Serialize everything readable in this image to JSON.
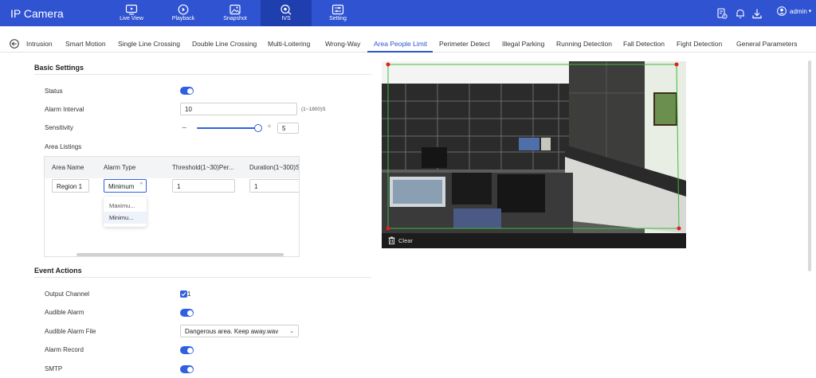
{
  "app": {
    "title": "IP Camera"
  },
  "nav": [
    {
      "label": "Live View",
      "icon": "live-view-icon"
    },
    {
      "label": "Playback",
      "icon": "playback-icon"
    },
    {
      "label": "Snapshot",
      "icon": "snapshot-icon"
    },
    {
      "label": "IVS",
      "icon": "ivs-icon",
      "active": true
    },
    {
      "label": "Setting",
      "icon": "setting-icon"
    }
  ],
  "user": {
    "name": "admin",
    "chevron": "▾"
  },
  "tabs": [
    "Intrusion",
    "Smart Motion",
    "Single Line Crossing",
    "Double Line Crossing",
    "Multi-Loitering",
    "Wrong-Way",
    "Area People Limit",
    "Perimeter Detect",
    "Illegal Parking",
    "Running Detection",
    "Fall Detection",
    "Fight Detection",
    "General Parameters"
  ],
  "active_tab": "Area People Limit",
  "basic": {
    "title": "Basic Settings",
    "status_label": "Status",
    "status_on": true,
    "interval_label": "Alarm Interval",
    "interval_value": "10",
    "interval_hint": "(1~1800)S",
    "sensitivity_label": "Sensitivity",
    "sensitivity_minus": "−",
    "sensitivity_plus": "+",
    "sensitivity_value": "5",
    "area_listings_label": "Area Listings"
  },
  "area_table": {
    "headers": [
      "Area Name",
      "Alarm Type",
      "Threshold(1~30)Per...",
      "Duration(1~300)S"
    ],
    "row": {
      "name": "Region 1",
      "alarm_type": "Minimum",
      "threshold": "1",
      "duration": "1"
    },
    "dropdown_options": [
      "Maximu...",
      "Minimu..."
    ],
    "dropdown_selected": "Minimu..."
  },
  "events": {
    "title": "Event Actions",
    "output_channel_label": "Output Channel",
    "output_channel_value": "1",
    "output_channel_checked": true,
    "audible_alarm_label": "Audible Alarm",
    "audible_alarm_on": true,
    "audible_file_label": "Audible Alarm File",
    "audible_file_value": "Dangerous area. Keep away.wav",
    "alarm_record_label": "Alarm Record",
    "alarm_record_on": true,
    "smtp_label": "SMTP",
    "smtp_on": true
  },
  "video": {
    "clear_label": "Clear",
    "region_color": "#3dbb3d",
    "vertex_color": "#e02020"
  },
  "colors": {
    "brand": "#2f53d1",
    "accent": "#2f60e0"
  }
}
